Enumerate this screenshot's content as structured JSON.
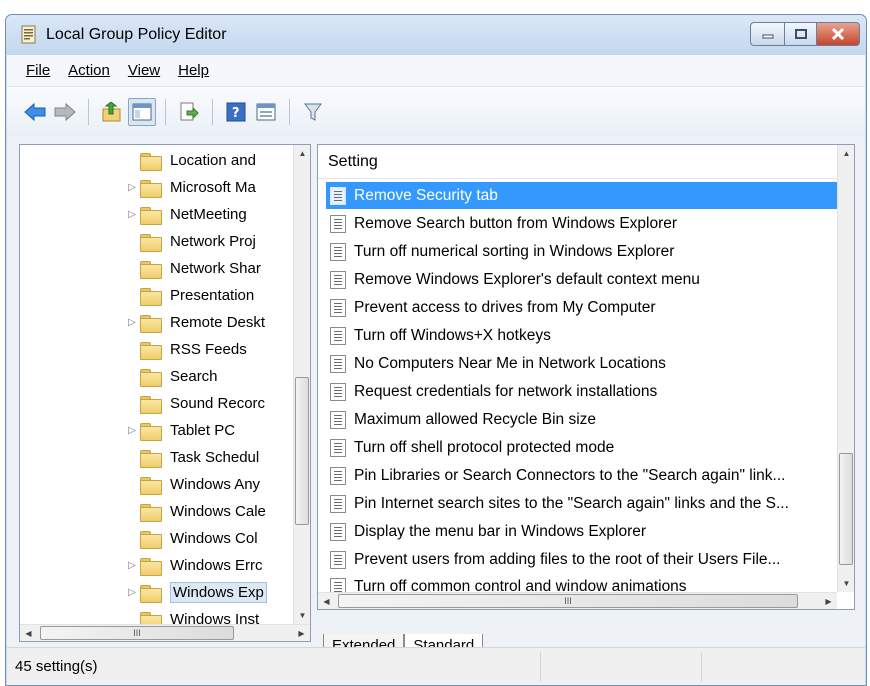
{
  "window": {
    "title": "Local Group Policy Editor"
  },
  "menu": [
    {
      "label": "File"
    },
    {
      "label": "Action"
    },
    {
      "label": "View"
    },
    {
      "label": "Help"
    }
  ],
  "toolbar": {
    "buttons": [
      "back-icon",
      "forward-icon",
      "up-folder-icon",
      "show-hide-tree-icon",
      "export-list-icon",
      "help-icon",
      "properties-icon",
      "filter-icon"
    ]
  },
  "tree": {
    "items": [
      {
        "label": "Location and",
        "expandable": false
      },
      {
        "label": "Microsoft Ma",
        "expandable": true
      },
      {
        "label": "NetMeeting",
        "expandable": true
      },
      {
        "label": "Network Proj",
        "expandable": false
      },
      {
        "label": "Network Shar",
        "expandable": false
      },
      {
        "label": "Presentation",
        "expandable": false
      },
      {
        "label": "Remote Deskt",
        "expandable": true
      },
      {
        "label": "RSS Feeds",
        "expandable": false
      },
      {
        "label": "Search",
        "expandable": false
      },
      {
        "label": "Sound Recorc",
        "expandable": false
      },
      {
        "label": "Tablet PC",
        "expandable": true
      },
      {
        "label": "Task Schedul",
        "expandable": false
      },
      {
        "label": "Windows Any",
        "expandable": false
      },
      {
        "label": "Windows Cale",
        "expandable": false
      },
      {
        "label": "Windows Col",
        "expandable": false
      },
      {
        "label": "Windows Errc",
        "expandable": true
      },
      {
        "label": "Windows Exp",
        "expandable": true,
        "selected": true
      },
      {
        "label": "Windows Inst",
        "expandable": false
      }
    ],
    "hscroll_label": "III"
  },
  "settings": {
    "column_header": "Setting",
    "rows": [
      {
        "label": "Remove Security tab",
        "selected": true
      },
      {
        "label": "Remove Search button from Windows Explorer"
      },
      {
        "label": "Turn off numerical sorting in Windows Explorer"
      },
      {
        "label": "Remove Windows Explorer's default context menu"
      },
      {
        "label": "Prevent access to drives from My Computer"
      },
      {
        "label": "Turn off Windows+X hotkeys"
      },
      {
        "label": "No Computers Near Me in Network Locations"
      },
      {
        "label": "Request credentials for network installations"
      },
      {
        "label": "Maximum allowed Recycle Bin size"
      },
      {
        "label": "Turn off shell protocol protected mode"
      },
      {
        "label": "Pin Libraries or Search Connectors to the \"Search again\" link..."
      },
      {
        "label": "Pin Internet search sites to the \"Search again\" links and the S..."
      },
      {
        "label": "Display the menu bar in Windows Explorer"
      },
      {
        "label": "Prevent users from adding files to the root of their Users File..."
      },
      {
        "label": "Turn off common control and window animations"
      }
    ],
    "hscroll_label": "III"
  },
  "tabs": [
    {
      "label": "Extended",
      "active": false
    },
    {
      "label": "Standard",
      "active": true
    }
  ],
  "status": {
    "text": "45 setting(s)"
  },
  "colors": {
    "selection": "#3399ff",
    "frame": "#c9dcf0"
  }
}
